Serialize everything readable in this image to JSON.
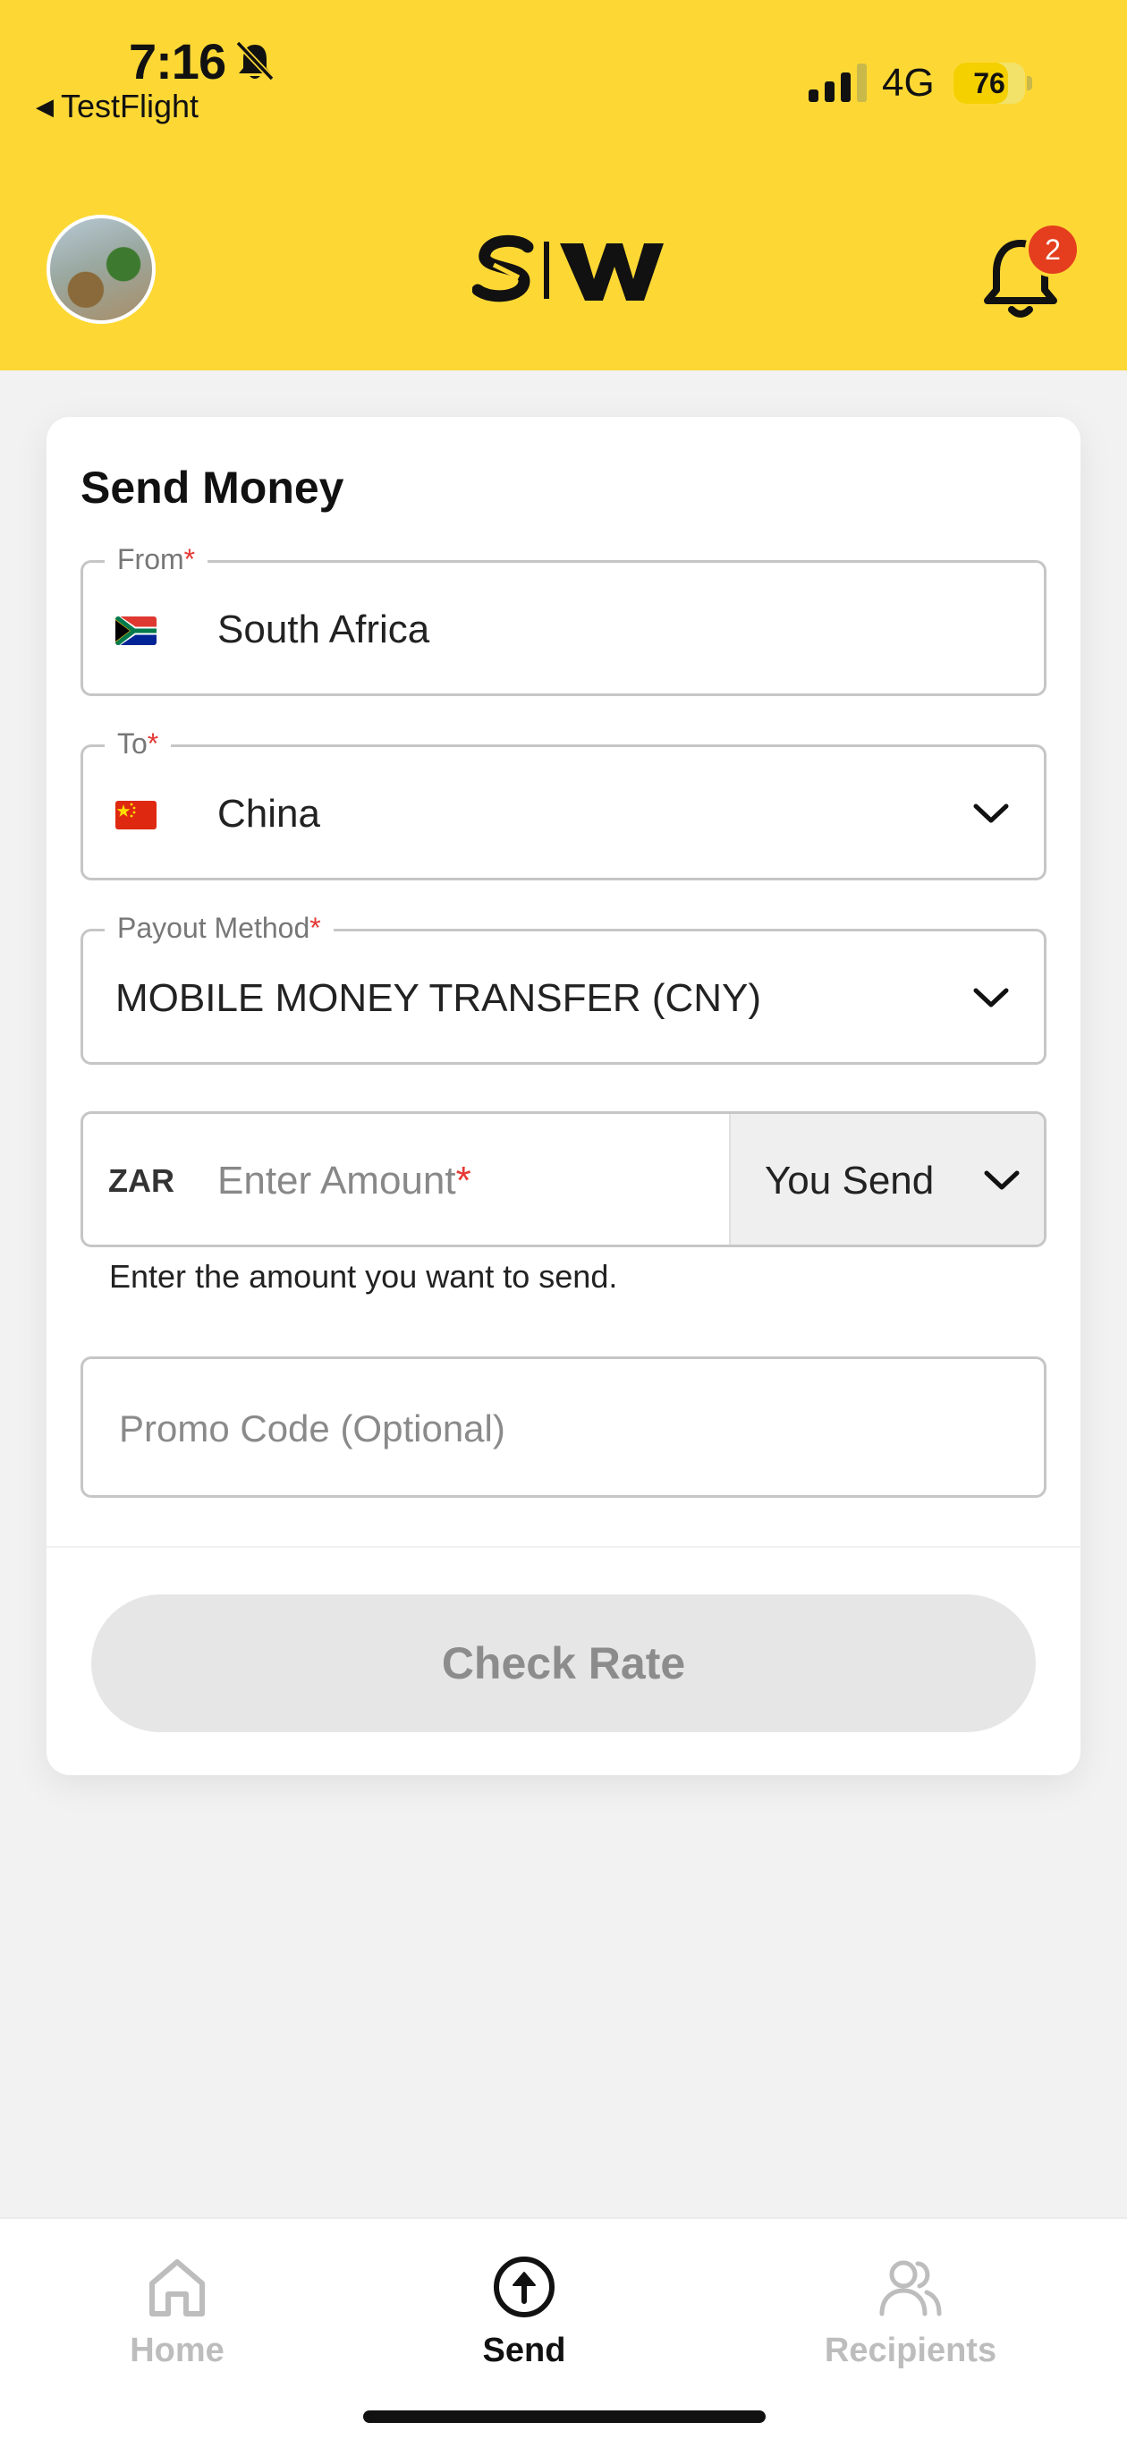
{
  "status_bar": {
    "time": "7:16",
    "back_app": "TestFlight",
    "network": "4G",
    "battery_percent": "76",
    "battery_level": 0.76
  },
  "header": {
    "logo_alt": "S|W",
    "notification_count": "2"
  },
  "send_money": {
    "title": "Send Money",
    "from": {
      "label": "From",
      "required": "*",
      "value": "South Africa",
      "flag": "south-africa-flag"
    },
    "to": {
      "label": "To",
      "required": "*",
      "value": "China",
      "flag": "china-flag"
    },
    "payout_method": {
      "label": "Payout Method",
      "required": "*",
      "value": "MOBILE MONEY TRANSFER (CNY)"
    },
    "amount": {
      "currency": "ZAR",
      "placeholder": "Enter Amount",
      "required": "*",
      "mode": "You Send",
      "helper": "Enter the amount you want to send."
    },
    "promo": {
      "placeholder": "Promo Code (Optional)"
    },
    "check_rate_label": "Check Rate"
  },
  "tabs": [
    {
      "label": "Home",
      "icon": "home-icon",
      "active": false
    },
    {
      "label": "Send",
      "icon": "send-icon",
      "active": true
    },
    {
      "label": "Recipients",
      "icon": "recipients-icon",
      "active": false
    }
  ],
  "colors": {
    "brand_yellow": "#fdd835",
    "badge_red": "#e53e1e",
    "required_red": "#e53935",
    "disabled_button": "#e6e6e6"
  }
}
